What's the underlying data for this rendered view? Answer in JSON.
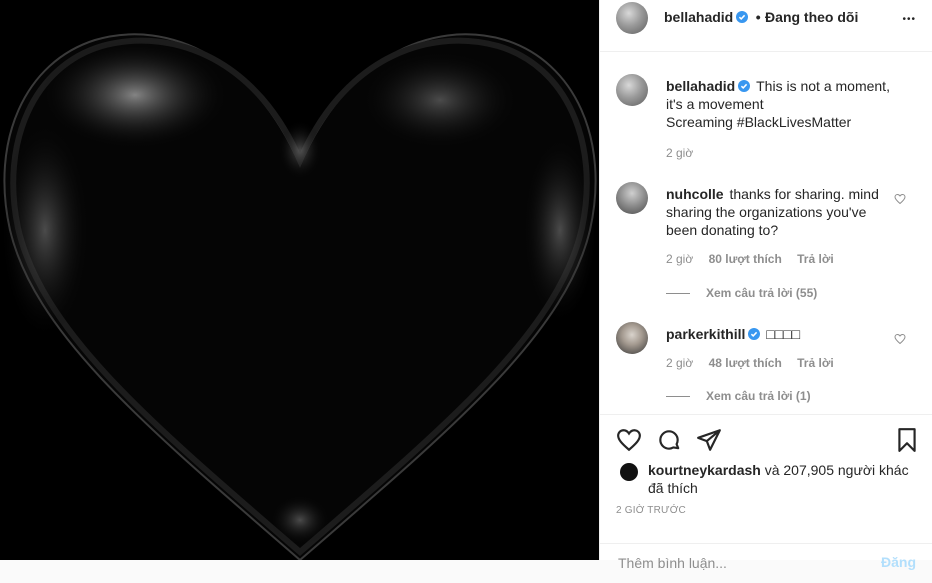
{
  "header": {
    "username": "bellahadid",
    "separator": "•",
    "follow_status": "Đang theo dõi",
    "more_label": "•••"
  },
  "caption": {
    "username": "bellahadid",
    "line1": "This is not a moment,",
    "line2": "it's a movement",
    "line3": "Screaming #BlackLivesMatter",
    "time": "2 giờ"
  },
  "comments": [
    {
      "username": "nuhcolle",
      "text_line1": "thanks for sharing. mind",
      "text_line2": "sharing the organizations you've",
      "text_line3": "been donating to?",
      "time": "2 giờ",
      "likes": "80 lượt thích",
      "reply": "Trả lời",
      "view_replies": "Xem câu trả lời (55)"
    },
    {
      "username": "parkerkithill",
      "text": "□□□□",
      "time": "2 giờ",
      "likes": "48 lượt thích",
      "reply": "Trả lời",
      "view_replies": "Xem câu trả lời (1)"
    }
  ],
  "likes": {
    "user": "kourtneykardash",
    "rest": "và 207,905 người khác",
    "line2": "đã thích"
  },
  "time_ago": "2 GIỜ TRƯỚC",
  "add_comment": {
    "placeholder": "Thêm bình luận...",
    "post": "Đăng"
  },
  "colors": {
    "verified": "#3897f0",
    "meta": "#8e8e8e",
    "post_disabled": "#b2dffc"
  }
}
